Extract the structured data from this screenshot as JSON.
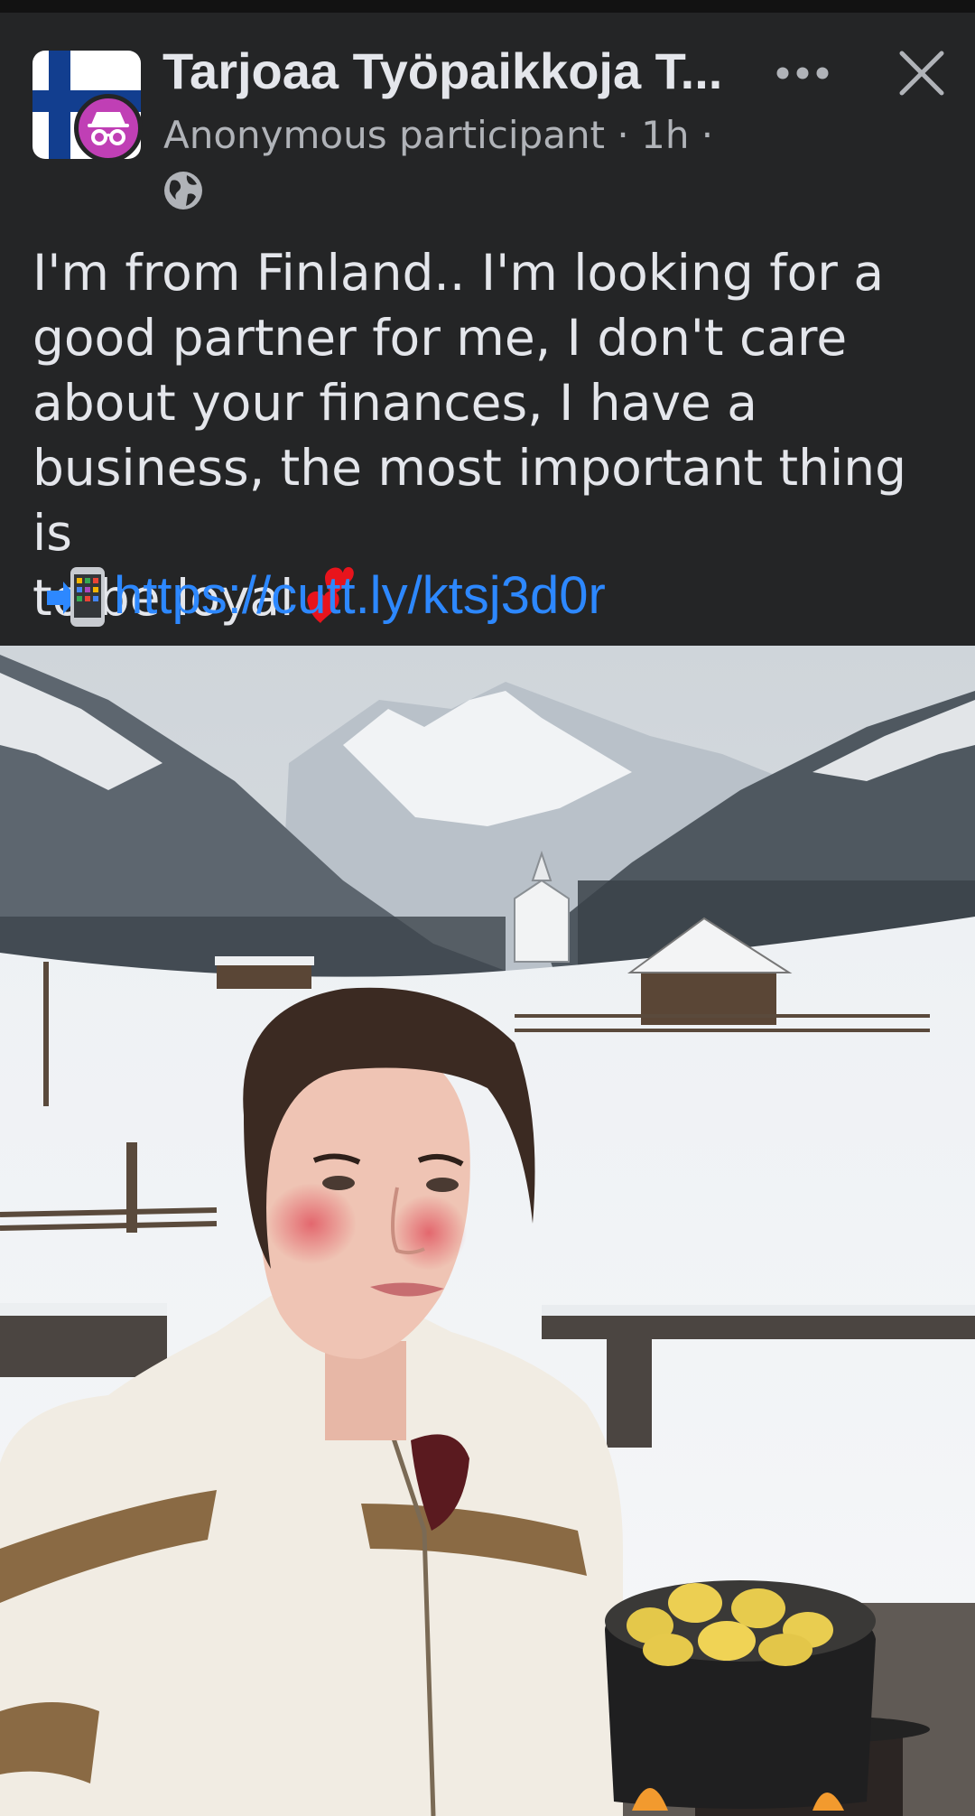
{
  "post": {
    "group_name": "Tarjoaa Työpaikkoja T...",
    "author": "Anonymous participant",
    "time": "1h",
    "body_lines": [
      "I'm from Finland.. I'm looking for a",
      "good partner for me, I don't care",
      "about your finances, I have a",
      "business, the most important thing is",
      "to be loyal"
    ],
    "link": "https://cutt.ly/ktsj3d0r"
  },
  "icons": {
    "group_avatar": "finland-flag-icon",
    "anon_badge": "incognito-icon",
    "more": "more-horizontal-icon",
    "close": "close-icon",
    "audience": "globe-icon",
    "hearts": "two-hearts-emoji",
    "phone": "mobile-arrow-emoji"
  },
  "colors": {
    "background": "#242526",
    "text": "#e4e6eb",
    "secondary": "#b0b3b8",
    "link": "#2d88ff",
    "anon_badge": "#c03fb5",
    "flag_blue": "#123e8f"
  }
}
